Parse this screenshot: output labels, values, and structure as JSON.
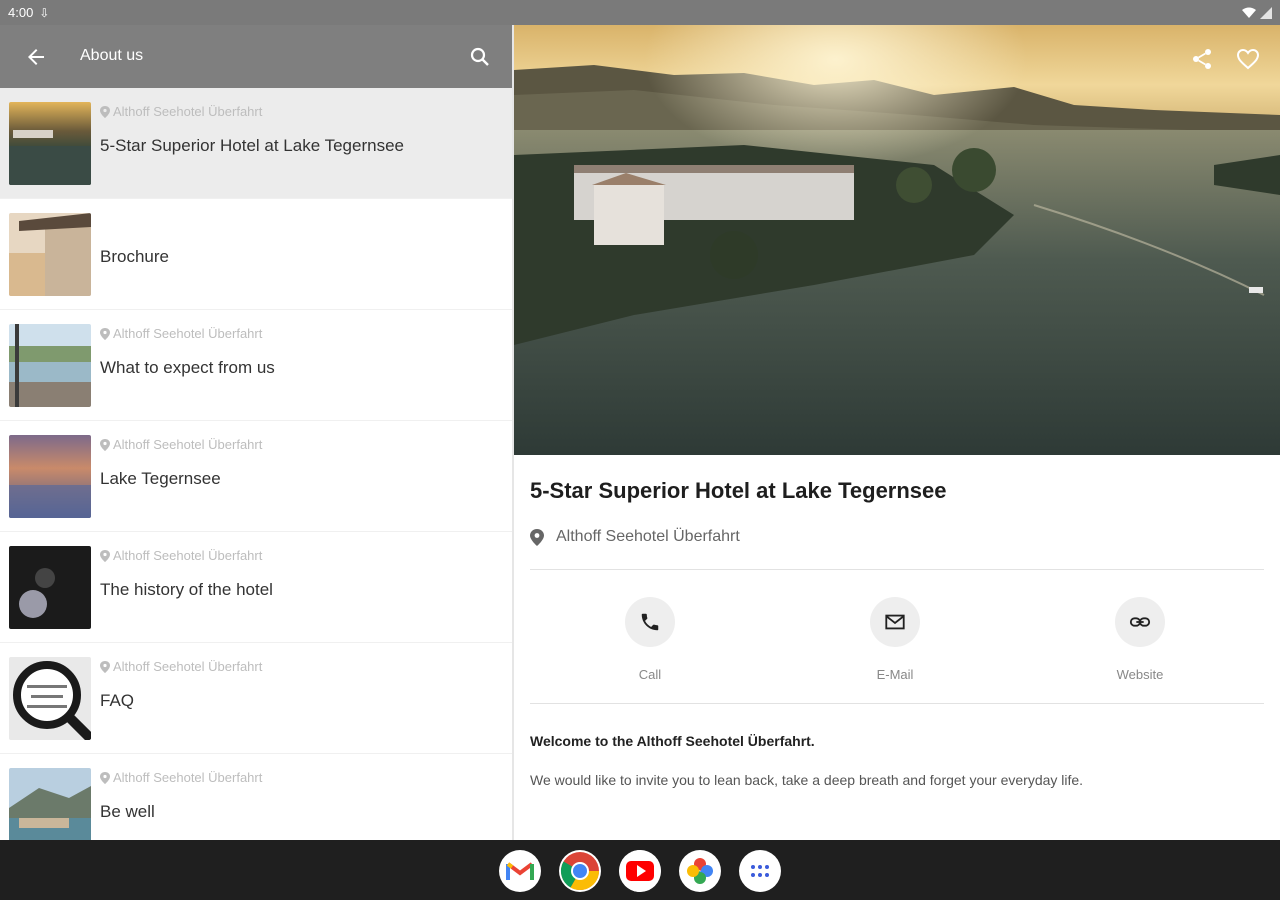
{
  "status": {
    "time": "4:00"
  },
  "appbar": {
    "title": "About us"
  },
  "list": [
    {
      "location": "Althoff Seehotel Überfahrt",
      "label": "5-Star Superior Hotel at Lake Tegernsee"
    },
    {
      "location": "",
      "label": "Brochure"
    },
    {
      "location": "Althoff Seehotel Überfahrt",
      "label": "What to expect from us"
    },
    {
      "location": "Althoff Seehotel Überfahrt",
      "label": "Lake Tegernsee"
    },
    {
      "location": "Althoff Seehotel Überfahrt",
      "label": "The history of the hotel"
    },
    {
      "location": "Althoff Seehotel Überfahrt",
      "label": "FAQ"
    },
    {
      "location": "Althoff Seehotel Überfahrt",
      "label": "Be well"
    }
  ],
  "detail": {
    "title": "5-Star Superior Hotel at Lake Tegernsee",
    "location": "Althoff Seehotel Überfahrt",
    "actions": {
      "call": "Call",
      "email": "E-Mail",
      "website": "Website"
    },
    "welcome": "Welcome to the Althoff Seehotel Überfahrt.",
    "invite": "We would like to invite you to lean back, take a deep breath and forget your everyday life."
  },
  "icons": [
    "back-arrow-icon",
    "search-icon",
    "share-icon",
    "heart-icon",
    "location-pin-icon",
    "phone-icon",
    "mail-icon",
    "link-icon",
    "gmail-icon",
    "chrome-icon",
    "youtube-icon",
    "photos-icon",
    "apps-icon"
  ]
}
